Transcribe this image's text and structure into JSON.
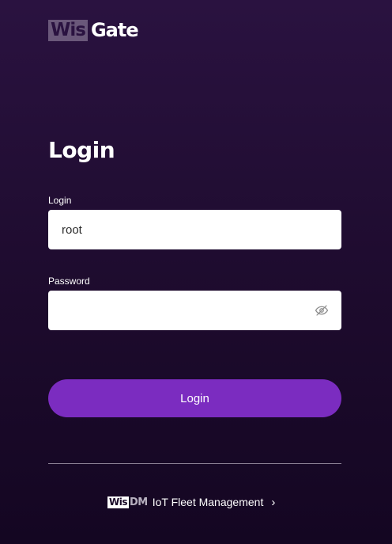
{
  "brand": {
    "logo_box_text": "Wis",
    "logo_text": "Gate"
  },
  "page": {
    "title": "Login"
  },
  "form": {
    "login_label": "Login",
    "login_value": "root",
    "password_label": "Password",
    "password_value": "",
    "submit_label": "Login"
  },
  "footer": {
    "logo_box_text": "Wis",
    "logo_text": "DM",
    "link_text": "IoT Fleet Management",
    "chevron": "›"
  },
  "icons": {
    "password_toggle": "eye-slash-icon",
    "footer_chevron": "chevron-right-icon"
  },
  "colors": {
    "background_top": "#2a1240",
    "background_bottom": "#140622",
    "primary_button": "#7b2cc0",
    "logo_box": "#6a587a"
  }
}
